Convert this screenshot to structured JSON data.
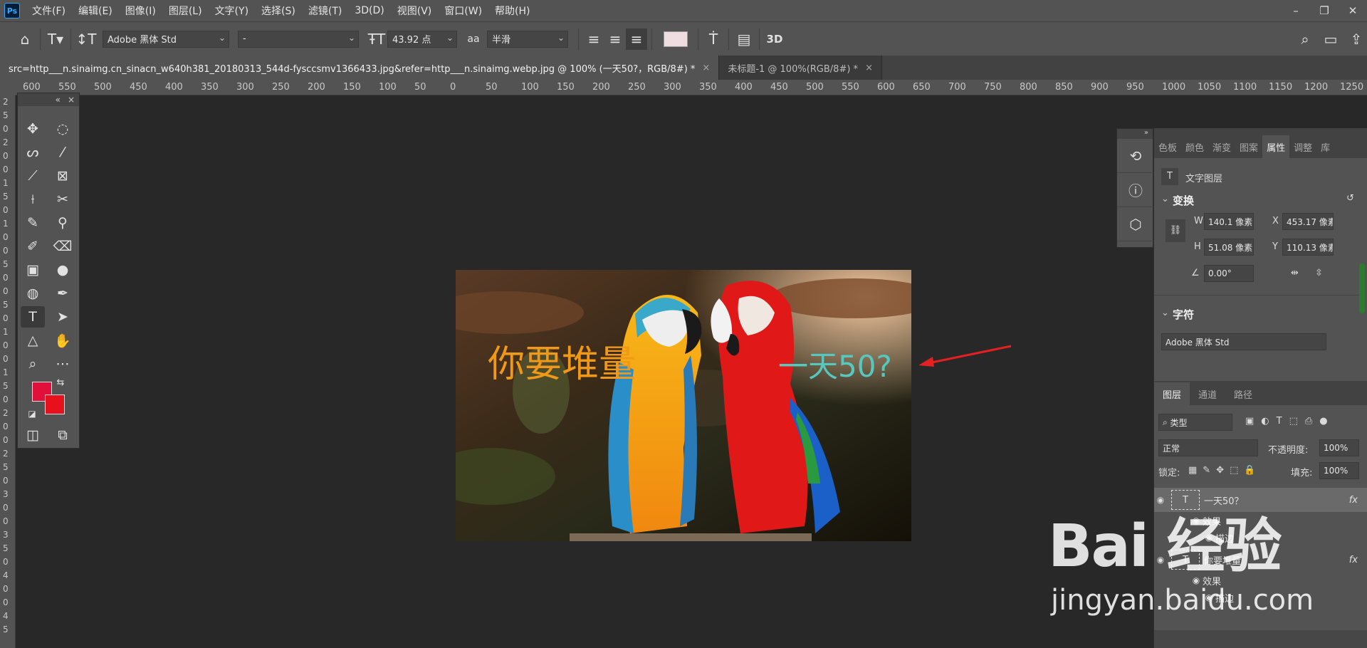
{
  "app": {
    "logo": "Ps"
  },
  "menu": [
    "文件(F)",
    "编辑(E)",
    "图像(I)",
    "图层(L)",
    "文字(Y)",
    "选择(S)",
    "滤镜(T)",
    "3D(D)",
    "视图(V)",
    "窗口(W)",
    "帮助(H)"
  ],
  "window_controls": {
    "minimize": "–",
    "restore": "❐",
    "close": "✕"
  },
  "options": {
    "font_family": "Adobe 黑体 Std",
    "font_style": "-",
    "font_size": "43.92 点",
    "aa_icon": "aa",
    "antialias": "半滑",
    "text_color": "#f0dde2"
  },
  "tabs": [
    {
      "label": "src=http___n.sinaimg.cn_sinacn_w640h381_20180313_544d-fysccsmv1366433.jpg&refer=http___n.sinaimg.webp.jpg @ 100% (一天50?，RGB/8#) *",
      "close": "×"
    },
    {
      "label": "未标题-1 @ 100%(RGB/8#) *",
      "close": "×"
    }
  ],
  "ruler_labels": [
    "600",
    "550",
    "500",
    "450",
    "400",
    "350",
    "300",
    "250",
    "200",
    "150",
    "100",
    "50",
    "0",
    "50",
    "100",
    "150",
    "200",
    "250",
    "300",
    "350",
    "400",
    "450",
    "500",
    "550",
    "600",
    "650",
    "700",
    "750",
    "800",
    "850",
    "900",
    "950",
    "1000",
    "1050",
    "1100",
    "1150",
    "1200",
    "1250"
  ],
  "vruler_labels": [
    "2",
    "5",
    "0",
    "2",
    "0",
    "0",
    "1",
    "5",
    "0",
    "1",
    "0",
    "0",
    "5",
    "0",
    "0",
    "5",
    "0",
    "1",
    "0",
    "0",
    "1",
    "5",
    "0",
    "2",
    "0",
    "0",
    "2",
    "5",
    "0",
    "3",
    "0",
    "0",
    "3",
    "5",
    "0",
    "4",
    "0",
    "0",
    "4",
    "5"
  ],
  "toolbox": {
    "collapse": "«",
    "close": "×"
  },
  "colors": {
    "foreground": "#e0103a",
    "background": "#e8101c"
  },
  "canvas": {
    "text_a": "你要堆量",
    "text_b": "一天50?"
  },
  "properties": {
    "tabs": [
      "色板",
      "颜色",
      "渐变",
      "图案",
      "属性",
      "调整",
      "库"
    ],
    "active_tab": "属性",
    "layer_type": "文字图层",
    "transform_title": "变换",
    "w_label": "W",
    "w": "140.1 像素",
    "h_label": "H",
    "h": "51.08 像素",
    "x_label": "X",
    "x": "453.17 像素",
    "y_label": "Y",
    "y": "110.13 像素",
    "angle": "0.00°",
    "char_title": "字符",
    "char_font": "Adobe 黑体 Std"
  },
  "layers": {
    "tabs": [
      "图层",
      "通道",
      "路径"
    ],
    "filter": "类型",
    "blend": "正常",
    "opacity_label": "不透明度:",
    "opacity": "100%",
    "lock_label": "锁定:",
    "fill_label": "填充:",
    "fill": "100%",
    "items": [
      {
        "name": "一天50？",
        "fx": "fx",
        "effects": "效果",
        "stroke": "描边"
      },
      {
        "name": "你要堆量",
        "fx": "fx",
        "effects": "效果",
        "stroke": "描边"
      }
    ]
  },
  "watermark": {
    "big": "Bai 经验",
    "small": "jingyan.baidu.com"
  }
}
